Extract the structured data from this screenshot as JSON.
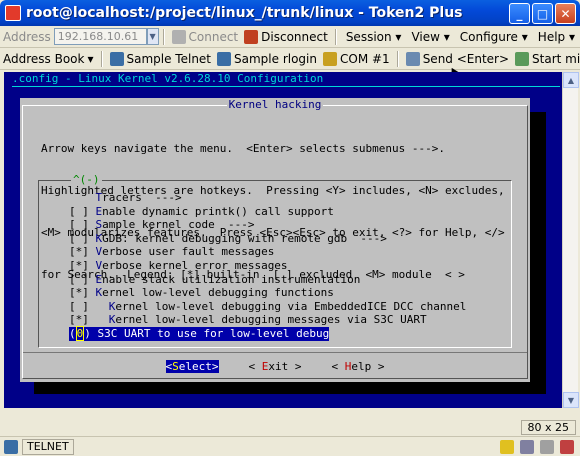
{
  "window": {
    "title": "root@localhost:/project/linux_/trunk/linux - Token2 Plus"
  },
  "toolbar1": {
    "address_label": "Address",
    "address_value": "192.168.10.61",
    "connect": "Connect",
    "disconnect": "Disconnect",
    "menus": [
      "Session",
      "View",
      "Configure",
      "Help"
    ]
  },
  "toolbar2": {
    "address_book": "Address Book",
    "sample_telnet": "Sample Telnet",
    "sample_rlogin": "Sample rlogin",
    "com1": "COM #1",
    "send_enter": "Send <Enter>",
    "start_midc": "Start midc"
  },
  "terminal": {
    "config_title": ".config - Linux Kernel v2.6.28.10 Configuration",
    "dialog_title": "Kernel hacking",
    "help_lines": [
      "Arrow keys navigate the menu.  <Enter> selects submenus --->.",
      "Highlighted letters are hotkeys.  Pressing <Y> includes, <N> excludes,",
      "<M> modularizes features.  Press <Esc><Esc> to exit, <?> for Help, </>",
      "for Search.  Legend: [*] built-in  [ ] excluded  <M> module  < >"
    ],
    "scroll_indicator": "^(-)",
    "items": [
      {
        "prefix": "    ",
        "hotkey": "T",
        "rest": "racers  --->"
      },
      {
        "prefix": "[ ] ",
        "hotkey": "E",
        "rest": "nable dynamic printk() call support"
      },
      {
        "prefix": "[ ] ",
        "hotkey": "S",
        "rest": "ample kernel code  --->"
      },
      {
        "prefix": "[ ] ",
        "hotkey": "K",
        "rest": "GDB: kernel debugging with remote gdb  --->"
      },
      {
        "prefix": "[*] ",
        "hotkey": "V",
        "rest": "erbose user fault messages"
      },
      {
        "prefix": "[*] ",
        "hotkey": "V",
        "rest": "erbose kernel error messages"
      },
      {
        "prefix": "[ ] ",
        "hotkey": "E",
        "rest": "nable stack utilization instrumentation"
      },
      {
        "prefix": "[*] ",
        "hotkey": "K",
        "rest": "ernel low-level debugging functions"
      },
      {
        "prefix": "[ ]   ",
        "hotkey": "K",
        "rest": "ernel low-level debugging via EmbeddedICE DCC channel"
      },
      {
        "prefix": "[*]   ",
        "hotkey": "K",
        "rest": "ernel low-level debugging messages via S3C UART"
      }
    ],
    "selected_item": {
      "prefix": "(",
      "hotkey": "0",
      "rest": ") S3C UART to use for low-level debug"
    },
    "buttons": {
      "select": {
        "pre": "<",
        "hotkey": "S",
        "post": "elect>"
      },
      "exit": {
        "pre": "< ",
        "hotkey": "E",
        "post": "xit >"
      },
      "help": {
        "pre": "< ",
        "hotkey": "H",
        "post": "elp >"
      }
    }
  },
  "status": {
    "size": "80 x 25",
    "protocol": "TELNET"
  },
  "colors": {
    "terminal_bg": "#000088",
    "dialog_bg": "#c0c0c0",
    "highlight": "#0000aa"
  }
}
